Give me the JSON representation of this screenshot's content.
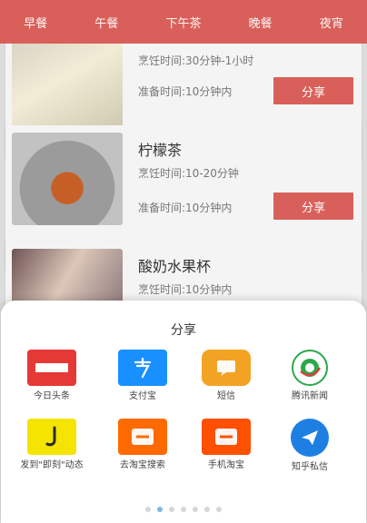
{
  "nav": {
    "tabs": [
      "早餐",
      "午餐",
      "下午茶",
      "晚餐",
      "夜宵"
    ]
  },
  "recipes": [
    {
      "title": "",
      "cook_time": "烹饪时间:30分钟-1小时",
      "prep_time": "准备时间:10分钟内",
      "share_label": "分享"
    },
    {
      "title": "柠檬茶",
      "cook_time": "烹饪时间:10-20分钟",
      "prep_time": "准备时间:10分钟内",
      "share_label": "分享"
    },
    {
      "title": "酸奶水果杯",
      "cook_time": "烹饪时间:10分钟内"
    }
  ],
  "share_sheet": {
    "title": "分享",
    "targets": [
      {
        "label": "今日头条",
        "icon": "toutiao-icon",
        "color": "#e53935"
      },
      {
        "label": "支付宝",
        "icon": "alipay-icon",
        "color": "#1890ff"
      },
      {
        "label": "短信",
        "icon": "sms-icon",
        "color": "#f3a324"
      },
      {
        "label": "腾讯新闻",
        "icon": "tencent-news-icon",
        "color": "#2aa84a"
      },
      {
        "label": "发到\"即刻\"动态",
        "icon": "jike-icon",
        "color": "#f4e400"
      },
      {
        "label": "去淘宝搜索",
        "icon": "taobao-search-icon",
        "color": "#ff6a00"
      },
      {
        "label": "手机淘宝",
        "icon": "mobile-taobao-icon",
        "color": "#ff5000"
      },
      {
        "label": "知乎私信",
        "icon": "zhihu-icon",
        "color": "#1e7fe3"
      }
    ],
    "page_dots": {
      "count": 7,
      "active": 1
    }
  }
}
